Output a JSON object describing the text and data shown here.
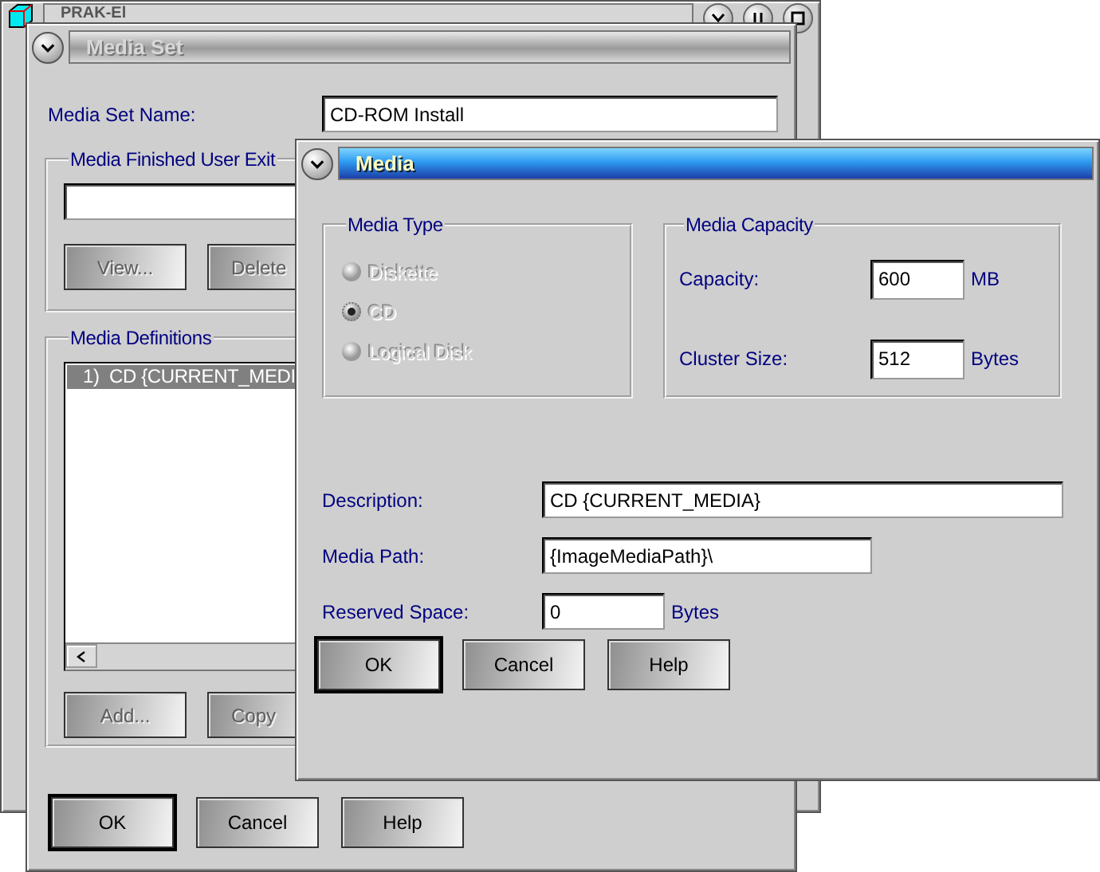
{
  "background_window": {
    "title": "PRAK-El"
  },
  "media_set_window": {
    "title": "Media Set",
    "fields": [
      {
        "label": "Media Set Name:",
        "value": "CD-ROM Install"
      }
    ],
    "user_exit_group": {
      "title": "Media Finished User Exit",
      "buttons": [
        {
          "label": "View...",
          "disabled": true
        },
        {
          "label": "Delete",
          "disabled": true
        }
      ]
    },
    "definitions_group": {
      "title": "Media Definitions",
      "items": [
        {
          "label": "1)  CD {CURRENT_MEDI",
          "selected": true
        }
      ],
      "buttons": [
        {
          "label": "Add...",
          "disabled": true
        },
        {
          "label": "Copy",
          "disabled": true
        }
      ]
    },
    "buttons": [
      {
        "label": "OK",
        "default": true
      },
      {
        "label": "Cancel",
        "default": false
      },
      {
        "label": "Help",
        "default": false
      }
    ]
  },
  "media_window": {
    "title": "Media",
    "active": true,
    "media_type": {
      "title": "Media Type",
      "options": [
        {
          "label": "Diskette",
          "selected": false,
          "disabled": true
        },
        {
          "label": "CD",
          "selected": true,
          "disabled": true
        },
        {
          "label": "Logical Disk",
          "selected": false,
          "disabled": true
        }
      ]
    },
    "media_capacity": {
      "title": "Media Capacity",
      "rows": [
        {
          "label": "Capacity:",
          "value": "600",
          "unit": "MB"
        },
        {
          "label": "Cluster Size:",
          "value": "512",
          "unit": "Bytes"
        }
      ]
    },
    "fields": [
      {
        "label": "Description:",
        "value": "CD {CURRENT_MEDIA}",
        "kind": "long"
      },
      {
        "label": "Media Path:",
        "value": "{ImageMediaPath}\\",
        "kind": "medium"
      },
      {
        "label": "Reserved Space:",
        "value": "0",
        "unit": "Bytes",
        "kind": "short"
      }
    ],
    "buttons": [
      {
        "label": "OK",
        "default": true
      },
      {
        "label": "Cancel",
        "default": false
      },
      {
        "label": "Help",
        "default": false
      }
    ]
  }
}
